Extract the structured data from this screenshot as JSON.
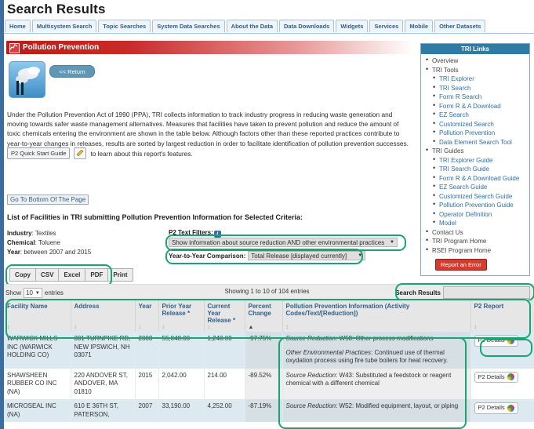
{
  "header": {
    "title": "Search Results",
    "nav": [
      "Home",
      "Multisystem Search",
      "Topic Searches",
      "System Data Searches",
      "About the Data",
      "Data Downloads",
      "Widgets",
      "Services",
      "Mobile",
      "Other Datasets"
    ]
  },
  "banner": {
    "title": "Pollution Prevention",
    "return_label": "<< Return"
  },
  "intro": {
    "paragraph": "Under the Pollution Prevention Act of 1990 (PPA), TRI collects information to track industry progress in reducing waste generation and moving towards safer waste management alternatives. Measures that facilities have taken to prevent pollution and reduce the amount of toxic chemicals entering the environment are shown in the table below. Although factors other than these reported practices contribute to year-to-year changes in releases, results are sorted by largest reduction in order to facilitate identification of pollution prevention successes. View the",
    "quick_start_label": "P2 Quick Start Guide",
    "after_quick_start": "to learn about this report's features."
  },
  "bottom_link": "Go To Bottom Of The Page",
  "list_heading": "List of Facilities in TRI submitting Pollution Prevention Information for Selected Criteria:",
  "criteria": {
    "industry_label": "Industry",
    "industry_value": "Textiles",
    "chemical_label": "Chemical",
    "chemical_value": "Toluene",
    "year_label": "Year",
    "year_value": "between 2007 and 2015"
  },
  "filters": {
    "p2_text_filters_label": "P2 Text Filters:",
    "p2_text_filter_value": "Show information about source reduction AND other environmental practices",
    "yty_label": "Year-to-Year Comparison:",
    "yty_value": "Total Release [displayed currently]"
  },
  "export": {
    "buttons": [
      "Copy",
      "CSV",
      "Excel",
      "PDF",
      "Print"
    ]
  },
  "table_controls": {
    "show_prefix": "Show",
    "show_value": "10",
    "show_suffix": "entries",
    "showing_text": "Showing 1 to 10 of 104 entries",
    "search_label": "Search Results",
    "search_value": "",
    "search_placeholder": ""
  },
  "table": {
    "columns": [
      {
        "label": "Facility Name",
        "sort": "none"
      },
      {
        "label": "Address",
        "sort": "none"
      },
      {
        "label": "Year",
        "sort": "none"
      },
      {
        "label": "Prior Year Release *",
        "sort": "none"
      },
      {
        "label": "Current Year Release *",
        "sort": "none"
      },
      {
        "label": "Percent Change",
        "sort": "asc"
      },
      {
        "label": "Pollution Prevention Information (Activity Codes/Text/[Reduction])",
        "sort": "none"
      },
      {
        "label": "P2 Report",
        "sort": "none"
      }
    ],
    "rows": [
      {
        "facility": "WARWICK MILLS INC (WARWICK HOLDING CO)",
        "address": "301 TURNPIKE RD, NEW IPSWICH, NH 03071",
        "year": "2008",
        "prior_year_release": "55,048.00",
        "current_year_release": "1,240.00",
        "percent_change": "-97.75%",
        "p2_info": [
          {
            "label": "Source Reduction",
            "text": "W58: Other process modifications"
          },
          {
            "label": "Other Environmental Practices",
            "text": "Continued use of thermal oxydation process using fire tube boilers for heat recovery."
          }
        ],
        "report_label": "P2 Details"
      },
      {
        "facility": "SHAWSHEEN RUBBER CO INC (NA)",
        "address": "220 ANDOVER ST, ANDOVER, MA 01810",
        "year": "2015",
        "prior_year_release": "2,042.00",
        "current_year_release": "214.00",
        "percent_change": "-89.52%",
        "p2_info": [
          {
            "label": "Source Reduction",
            "text": "W43: Substituted a feedstock or reagent chemical with a different chemical"
          }
        ],
        "report_label": "P2 Details"
      },
      {
        "facility": "MICROSEAL INC (NA)",
        "address": "610 E 36TH ST, PATERSON,",
        "year": "2007",
        "prior_year_release": "33,190.00",
        "current_year_release": "4,252.00",
        "percent_change": "-87.19%",
        "p2_info": [
          {
            "label": "Source Reduction",
            "text": "W52: Modified equipment, layout, or piping"
          }
        ],
        "report_label": "P2 Details"
      }
    ]
  },
  "sidebar": {
    "title": "TRI Links",
    "groups": [
      {
        "label": "Overview",
        "items": []
      },
      {
        "label": "TRI Tools",
        "items": [
          "TRI Explorer",
          "TRI Search",
          "Form R Search",
          "Form R & A Download",
          "EZ Search",
          "Customized Search",
          "Pollution Prevention",
          "Data Element Search Tool"
        ]
      },
      {
        "label": "TRI Guides",
        "items": [
          "TRI Explorer Guide",
          "TRI Search Guide",
          "Form R & A Download Guide",
          "EZ Search Guide",
          "Customized Search Guide",
          "Pollution Prevention Guide",
          "Operator Definition",
          "Model"
        ]
      },
      {
        "label": "Contact Us",
        "items": []
      },
      {
        "label": "TRI Program Home",
        "items": []
      },
      {
        "label": "RSEI Program Home",
        "items": []
      }
    ],
    "report_error": "Report an Error"
  },
  "colors": {
    "brand_red": "#bd1b1b",
    "link_blue": "#2f6fae",
    "highlight_green": "#17a673",
    "sidebar_header": "#2f7ba3"
  }
}
